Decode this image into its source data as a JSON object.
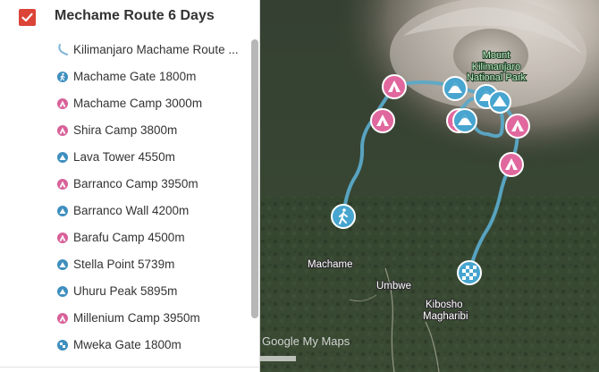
{
  "layer": {
    "title": "Mechame Route 6 Days",
    "checked": true,
    "accent_color": "#db4437"
  },
  "features": [
    {
      "label": "Kilimanjaro Machame Route ...",
      "icon": "route-line-icon",
      "color": "#7fb4d8"
    },
    {
      "label": "Machame Gate 1800m",
      "icon": "hiker-icon",
      "color": "#3f8fbf"
    },
    {
      "label": "Machame Camp 3000m",
      "icon": "tent-icon",
      "color": "#d8619a"
    },
    {
      "label": "Shira Camp 3800m",
      "icon": "tent-icon",
      "color": "#d8619a"
    },
    {
      "label": "Lava Tower 4550m",
      "icon": "mountain-icon",
      "color": "#3f8fbf"
    },
    {
      "label": "Barranco Camp 3950m",
      "icon": "tent-icon",
      "color": "#d8619a"
    },
    {
      "label": "Barranco Wall 4200m",
      "icon": "mountain-icon",
      "color": "#3f8fbf"
    },
    {
      "label": "Barafu Camp 4500m",
      "icon": "tent-icon",
      "color": "#d8619a"
    },
    {
      "label": "Stella Point 5739m",
      "icon": "mountain-icon",
      "color": "#3f8fbf"
    },
    {
      "label": "Uhuru Peak 5895m",
      "icon": "mountain-icon",
      "color": "#3f8fbf"
    },
    {
      "label": "Millenium Camp 3950m",
      "icon": "tent-icon",
      "color": "#d8619a"
    },
    {
      "label": "Mweka Gate 1800m",
      "icon": "finish-flag-icon",
      "color": "#3f8fbf"
    }
  ],
  "map": {
    "labels": {
      "machame": "Machame",
      "umbwe": "Umbwe",
      "kibosho": "Kibosho",
      "magharibi": "Magharibi",
      "park_line1": "Mount",
      "park_line2": "Kilimanjaro",
      "park_line3": "National Park"
    },
    "brand": "Google My Maps",
    "route_color": "#5aa9c8",
    "tent_marker_color": "#e0689e",
    "mountain_marker_color": "#47a5cf"
  }
}
